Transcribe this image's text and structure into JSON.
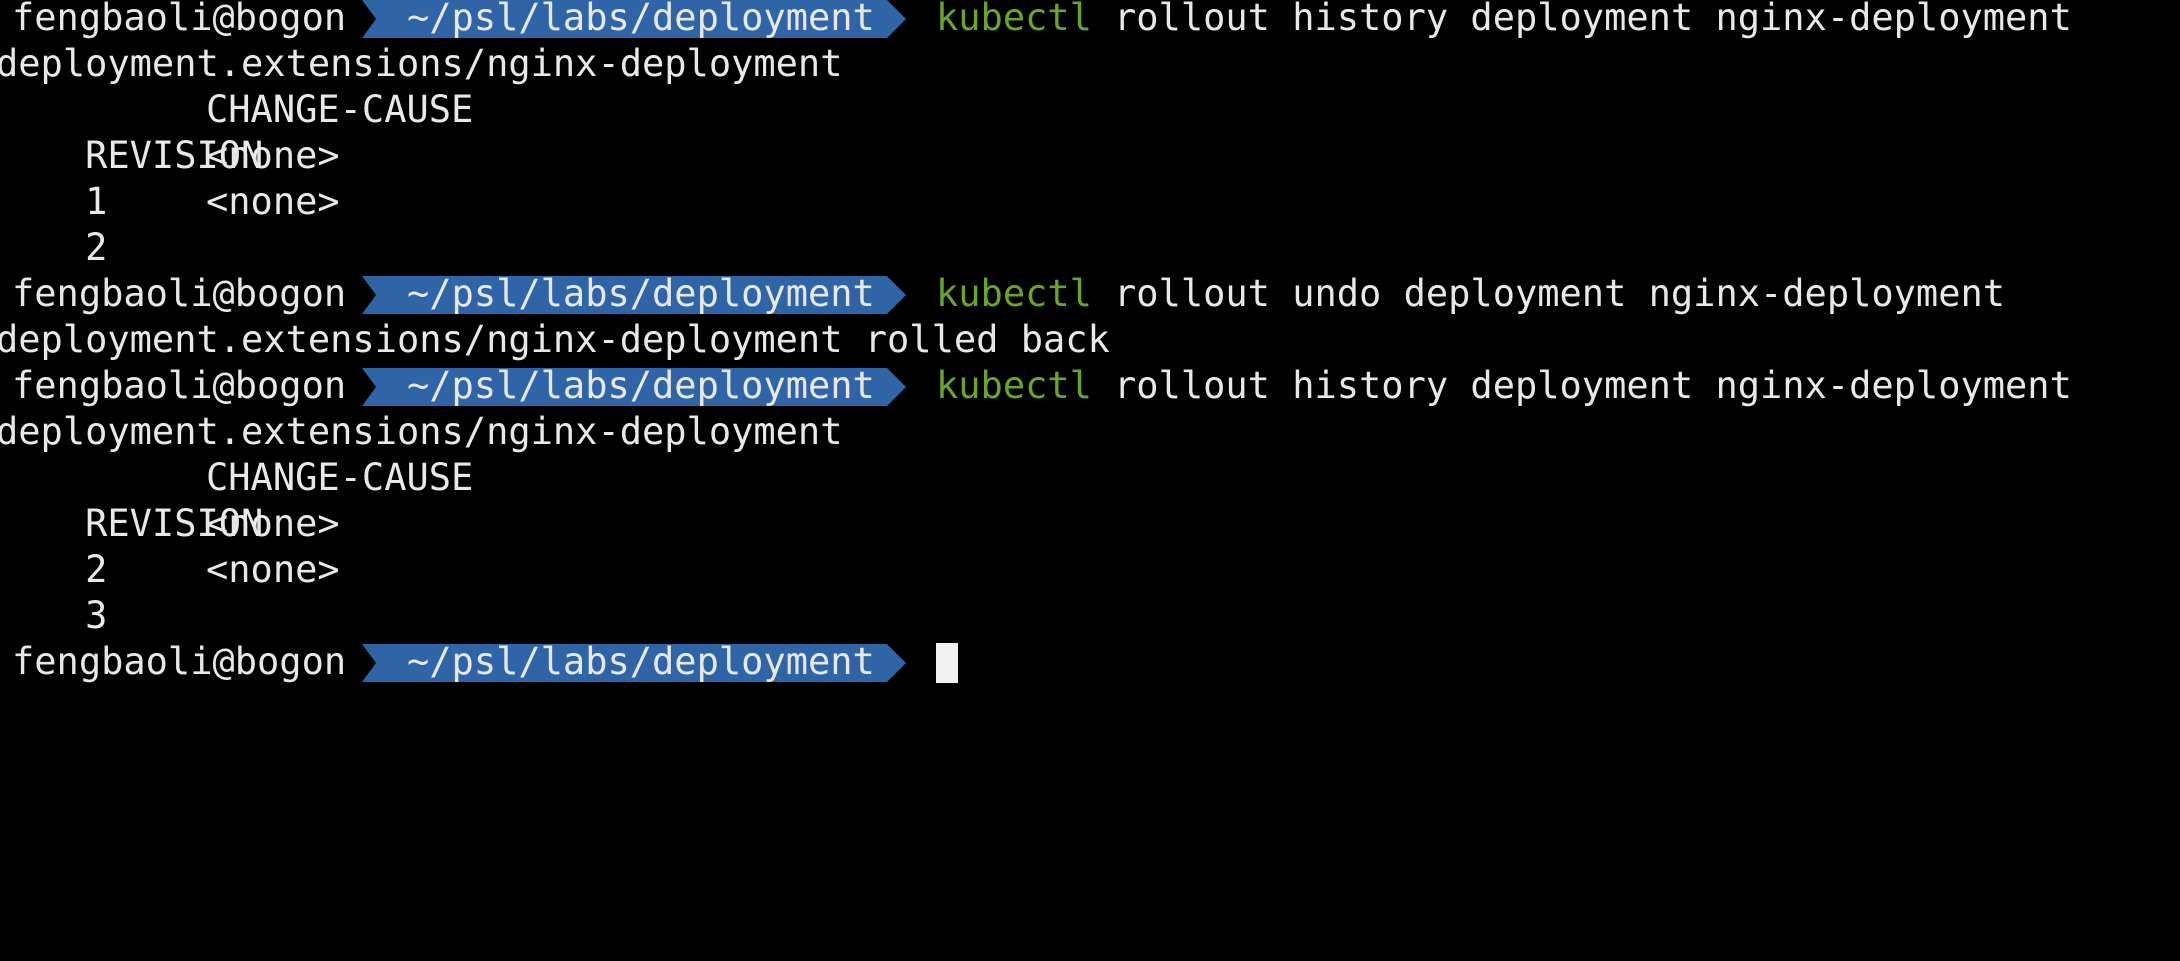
{
  "prompt": {
    "user_host": "fengbaoli@bogon",
    "cwd": "~/psl/labs/deployment"
  },
  "commands": [
    {
      "name": "kubectl",
      "args": "rollout history deployment nginx-deployment"
    },
    {
      "name": "kubectl",
      "args": "rollout undo deployment nginx-deployment"
    },
    {
      "name": "kubectl",
      "args": "rollout history deployment nginx-deployment"
    }
  ],
  "outputs": {
    "history1": {
      "resource": "deployment.extensions/nginx-deployment",
      "headers": [
        "REVISION",
        "CHANGE-CAUSE"
      ],
      "rows": [
        [
          "1",
          "<none>"
        ],
        [
          "2",
          "<none>"
        ]
      ]
    },
    "undo": {
      "message": "deployment.extensions/nginx-deployment rolled back"
    },
    "history2": {
      "resource": "deployment.extensions/nginx-deployment",
      "headers": [
        "REVISION",
        "CHANGE-CAUSE"
      ],
      "rows": [
        [
          "2",
          "<none>"
        ],
        [
          "3",
          "<none>"
        ]
      ]
    }
  },
  "colors": {
    "background": "#000000",
    "text": "#e8e8e8",
    "path_segment": "#2f65a7",
    "command": "#6aa621",
    "cursor": "#f2f2f2"
  }
}
